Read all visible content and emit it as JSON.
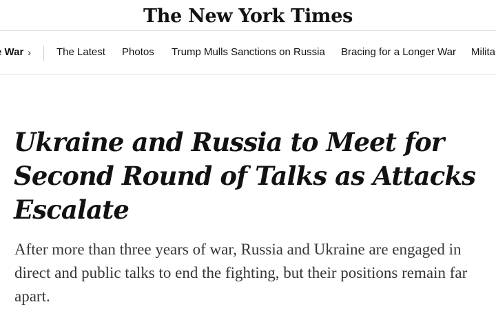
{
  "masthead": {
    "logo_text": "The New York Times"
  },
  "nav": {
    "section_label": "e War",
    "section_chevron": "›",
    "items": [
      {
        "label": "The Latest"
      },
      {
        "label": "Photos"
      },
      {
        "label": "Trump Mulls Sanctions on Russia"
      },
      {
        "label": "Bracing for a Longer War"
      },
      {
        "label": "Milita"
      }
    ]
  },
  "article": {
    "headline": "Ukraine and Russia to Meet for Second Round of Talks as Attacks Escalate",
    "summary": "After more than three years of war, Russia and Ukraine are engaged in direct and public talks to end the fighting, but their positions remain far apart."
  },
  "colors": {
    "text": "#121212",
    "summary_text": "#363636",
    "divider": "#dcdcdc",
    "background": "#ffffff"
  }
}
